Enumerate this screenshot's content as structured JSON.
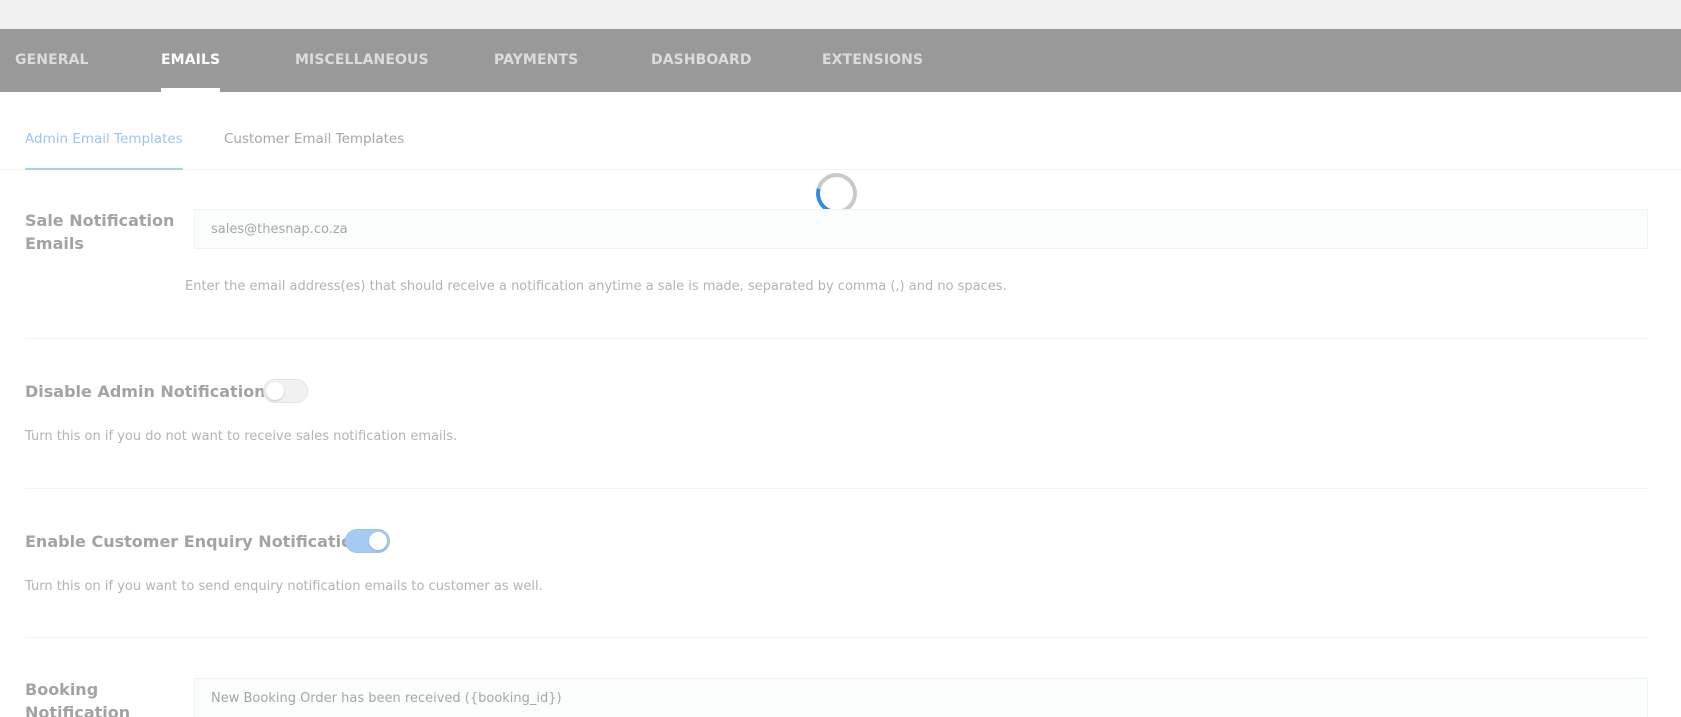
{
  "main_tabs": [
    {
      "label": "GENERAL",
      "active": false
    },
    {
      "label": "EMAILS",
      "active": true
    },
    {
      "label": "MISCELLANEOUS",
      "active": false
    },
    {
      "label": "PAYMENTS",
      "active": false
    },
    {
      "label": "DASHBOARD",
      "active": false
    },
    {
      "label": "EXTENSIONS",
      "active": false
    }
  ],
  "sub_tabs": [
    {
      "label": "Admin Email Templates",
      "active": true
    },
    {
      "label": "Customer Email Templates",
      "active": false
    }
  ],
  "settings": {
    "sale_notification": {
      "label": "Sale Notification Emails",
      "value": "sales@thesnap.co.za",
      "help": "Enter the email address(es) that should receive a notification anytime a sale is made, separated by comma (,) and no spaces."
    },
    "disable_admin_notification": {
      "label": "Disable Admin Notification",
      "enabled": false,
      "help": "Turn this on if you do not want to receive sales notification emails."
    },
    "enable_customer_enquiry": {
      "label": "Enable Customer Enquiry Notification",
      "enabled": true,
      "help": "Turn this on if you want to send enquiry notification emails to customer as well."
    },
    "booking_notification": {
      "label": "Booking Notification",
      "value": "New Booking Order has been received ({booking_id})"
    }
  },
  "colors": {
    "nav_background": "#999999",
    "accent": "#2f8ce8",
    "toggle_on": "#a6cbf3"
  },
  "icons": {
    "loading": "spinner-icon"
  }
}
